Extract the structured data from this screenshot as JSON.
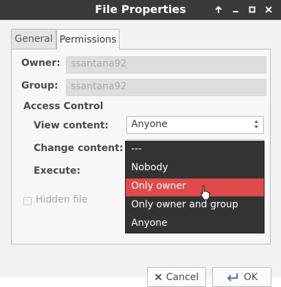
{
  "window": {
    "title": "File Properties"
  },
  "tabs": [
    {
      "label": "General"
    },
    {
      "label": "Permissions"
    }
  ],
  "fields": {
    "owner_label": "Owner:",
    "owner_value": "ssantana92",
    "group_label": "Group:",
    "group_value": "ssantana92"
  },
  "access_control": {
    "heading": "Access Control",
    "view_label": "View content:",
    "view_value": "Anyone",
    "change_label": "Change content:",
    "execute_label": "Execute:"
  },
  "hidden_file": {
    "label": "Hidden file",
    "checked": false
  },
  "dropdown": {
    "options": [
      "---",
      "Nobody",
      "Only owner",
      "Only owner and group",
      "Anyone"
    ],
    "selected": "Only owner"
  },
  "buttons": {
    "cancel": "Cancel",
    "ok": "OK"
  },
  "colors": {
    "titlebar": "#3a3a3a",
    "selection": "#e04a4a",
    "dropdown_bg": "#333333"
  }
}
